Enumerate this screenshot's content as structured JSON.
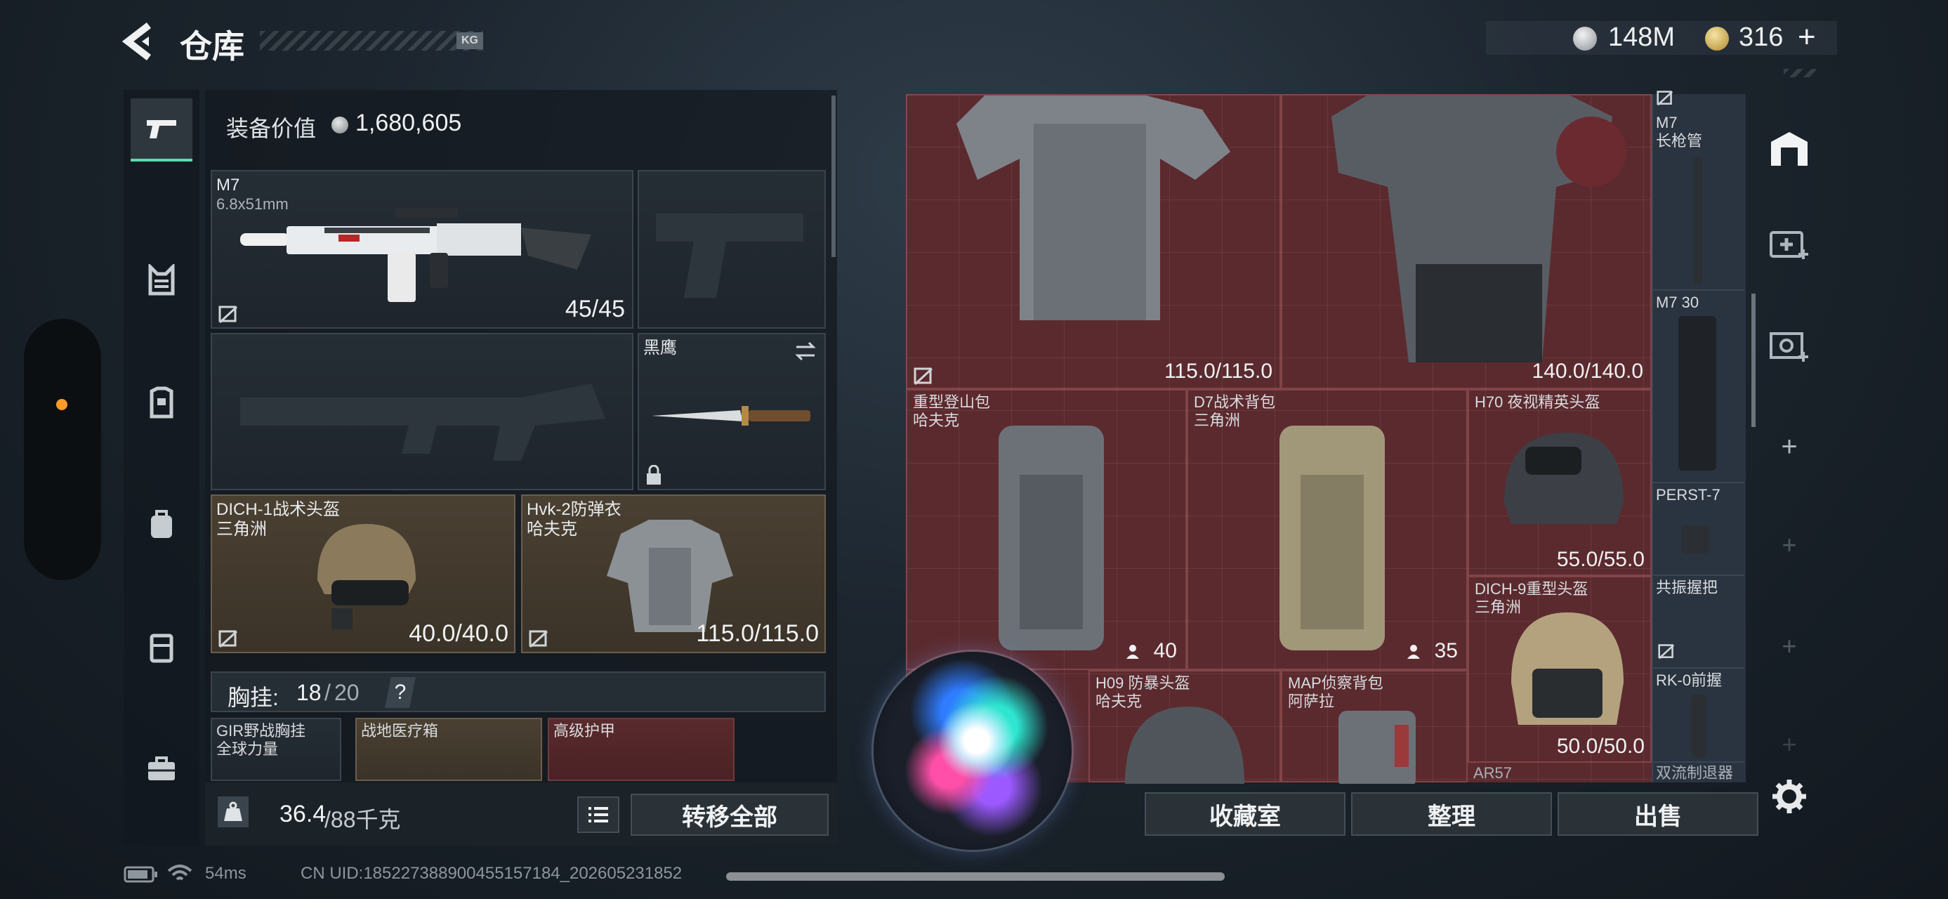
{
  "header": {
    "title": "仓库",
    "tag": "KG",
    "currency1": "148M",
    "currency2": "316",
    "plus": "+"
  },
  "left": {
    "equip_value_label": "装备价值",
    "equip_value": "1,680,605",
    "weapon_primary": {
      "name": "M7",
      "caliber": "6.8x51mm",
      "ammo": "45/45"
    },
    "melee": {
      "name": "黑鹰"
    },
    "helmet": {
      "name": "DICH-1战术头盔",
      "brand": "三角洲",
      "durability": "40.0/40.0"
    },
    "armor": {
      "name": "Hvk-2防弹衣",
      "brand": "哈夫克",
      "durability": "115.0/115.0"
    },
    "chest": {
      "label": "胸挂:",
      "current": "18",
      "slash": "/",
      "max": "20",
      "help": "?"
    },
    "chest_items": [
      {
        "name": "GIR野战胸挂",
        "sub": "全球力量"
      },
      {
        "name": "战地医疗箱",
        "sub": ""
      },
      {
        "name": "高级护甲",
        "sub": ""
      }
    ],
    "weight_value": "36.4",
    "weight_max": "/88千克",
    "transfer_all": "转移全部"
  },
  "grid": {
    "top_left_durability": "115.0/115.0",
    "top_right_durability": "140.0/140.0",
    "items": [
      {
        "name": "重型登山包",
        "brand": "哈夫克",
        "count": "40"
      },
      {
        "name": "D7战术背包",
        "brand": "三角洲",
        "count": "35"
      },
      {
        "name": "H70 夜视精英头盔",
        "brand": "",
        "durability": "55.0/55.0"
      },
      {
        "name": "DICH-9重型头盔",
        "brand": "三角洲",
        "durability": "50.0/50.0"
      },
      {
        "name": "H09 防暴头盔",
        "brand": "哈夫克"
      },
      {
        "name": "MAP侦察背包",
        "brand": "阿萨拉"
      },
      {
        "name": "AR57",
        "brand": ""
      }
    ],
    "column": [
      {
        "name": "M7",
        "sub": "长枪管"
      },
      {
        "name": "M7 30",
        "sub": ""
      },
      {
        "name": "PERST-7",
        "sub": ""
      },
      {
        "name": "共振握把",
        "sub": ""
      },
      {
        "name": "RK-0前握",
        "sub": ""
      },
      {
        "name": "双流制退器",
        "sub": ""
      }
    ]
  },
  "bottom": {
    "collection": "收藏室",
    "sort": "整理",
    "sell": "出售"
  },
  "status": {
    "ping": "54ms",
    "uid": "CN UID:1852273889004551571​84_202605231852"
  },
  "colors": {
    "accent": "#5fd8b0",
    "grid_red": "#5b2a2e",
    "tan": "#4a4032"
  }
}
